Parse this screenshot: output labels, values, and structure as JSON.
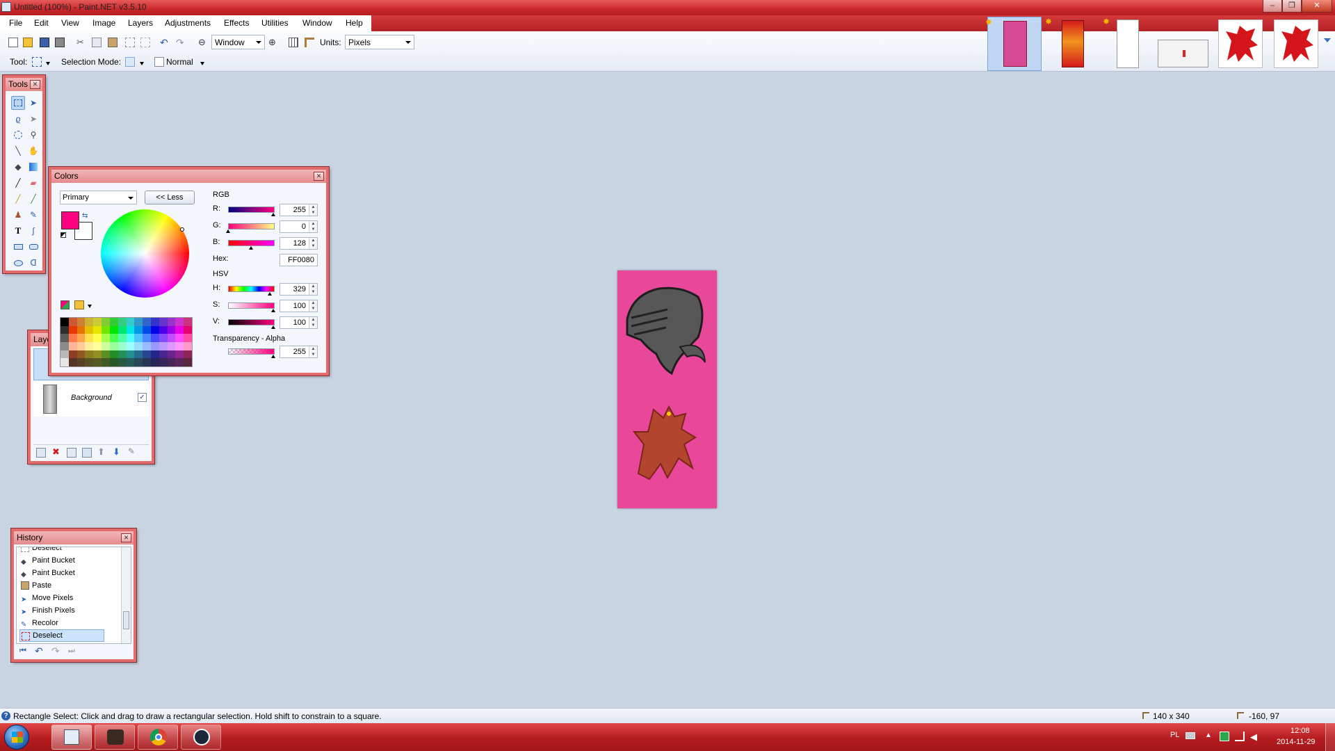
{
  "window": {
    "title": "Untitled (100%) - Paint.NET v3.5.10"
  },
  "menu": [
    "File",
    "Edit",
    "View",
    "Image",
    "Layers",
    "Adjustments",
    "Effects",
    "Utilities",
    "Window",
    "Help"
  ],
  "toolbar": {
    "zoom_value": "Window",
    "units_label": "Units:",
    "units_value": "Pixels",
    "tool_label": "Tool:",
    "selection_mode_label": "Selection Mode:",
    "blend_mode": "Normal"
  },
  "tools_panel": {
    "title": "Tools"
  },
  "colors_panel": {
    "title": "Colors",
    "target": "Primary",
    "less_button": "<< Less",
    "rgb_header": "RGB",
    "hsv_header": "HSV",
    "r_label": "R:",
    "r": "255",
    "g_label": "G:",
    "g": "0",
    "b_label": "B:",
    "b": "128",
    "hex_label": "Hex:",
    "hex": "FF0080",
    "h_label": "H:",
    "h": "329",
    "s_label": "S:",
    "s": "100",
    "v_label": "V:",
    "v": "100",
    "alpha_label": "Transparency - Alpha",
    "alpha": "255",
    "primary_color": "#ff0080"
  },
  "layers_panel": {
    "title": "Layers",
    "layers": [
      {
        "name": "Background"
      }
    ]
  },
  "history_panel": {
    "title": "History",
    "items": [
      "Deselect",
      "Paint Bucket",
      "Paint Bucket",
      "Paste",
      "Move Pixels",
      "Finish Pixels",
      "Recolor",
      "Deselect"
    ]
  },
  "status": {
    "hint": "Rectangle Select: Click and drag to draw a rectangular selection. Hold shift to constrain to a square.",
    "image_size": "140 x 340",
    "cursor_pos": "-160, 97"
  },
  "taskbar": {
    "lang": "PL",
    "time": "12:08",
    "date": "2014-11-29"
  },
  "colors": {
    "accent": "#c8282c",
    "canvas_bg": "#c9d4e3",
    "banner_pink": "#e8479a"
  }
}
